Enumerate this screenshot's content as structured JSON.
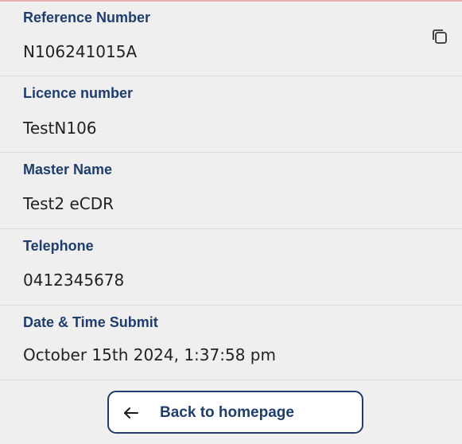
{
  "details": {
    "reference_number": {
      "label": "Reference Number",
      "value": "N106241015A",
      "action_icon": "copy-icon"
    },
    "licence_number": {
      "label": "Licence number",
      "value": "TestN106"
    },
    "master_name": {
      "label": "Master Name",
      "value": "Test2 eCDR"
    },
    "telephone": {
      "label": "Telephone",
      "value": "0412345678"
    },
    "date_time_submit": {
      "label": "Date & Time Submit",
      "value": "October 15th 2024, 1:37:58 pm"
    }
  },
  "footer": {
    "back_button": {
      "label": "Back to homepage",
      "icon": "arrow-left-icon"
    }
  },
  "colors": {
    "background": "#efefef",
    "label": "#1f3d6e",
    "value": "#222222",
    "divider": "#dcdcdc",
    "button_border": "#1f3d6e"
  }
}
